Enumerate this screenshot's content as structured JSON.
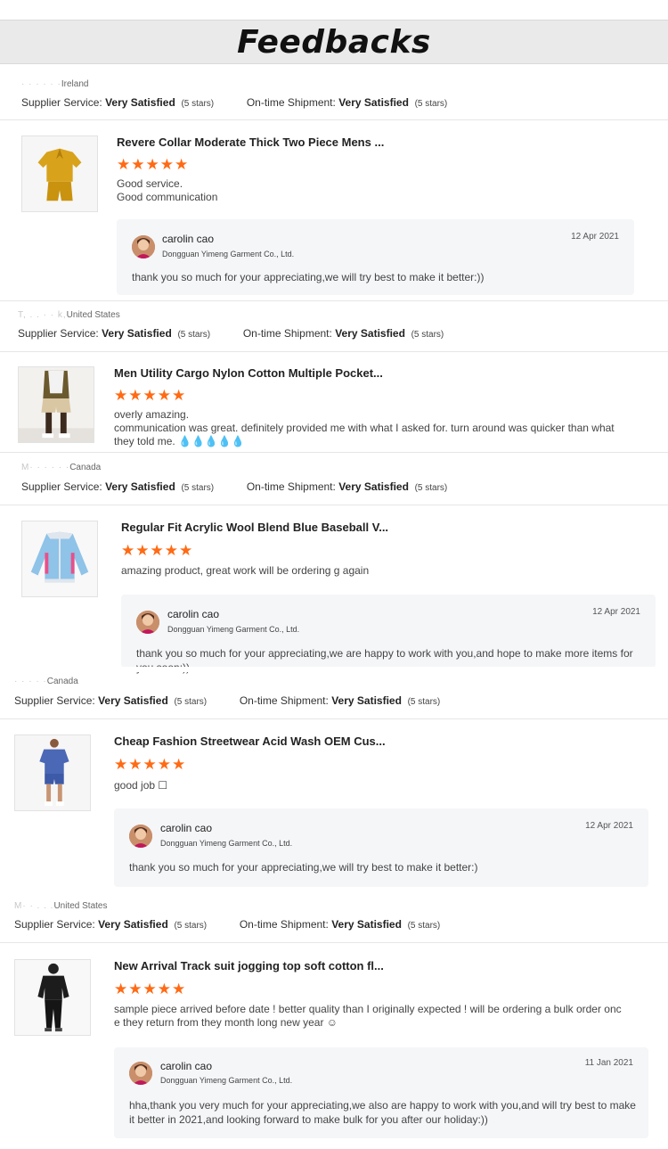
{
  "header": {
    "title": "Feedbacks"
  },
  "labels": {
    "supplier_service": "Supplier Service:",
    "ontime_shipment": "On-time Shipment:",
    "rating_text": "Very Satisfied",
    "stars_note": "(5 stars)",
    "stars_glyph": "★★★★★"
  },
  "feedbacks": [
    {
      "buyer_blur": "· · ·  · · ·",
      "buyer_country": "Ireland",
      "product_title": "Revere Collar Moderate Thick Two Piece Mens ...",
      "review": [
        "Good service.",
        "Good communication"
      ],
      "reply": {
        "name": "carolin cao",
        "company": "Dongguan Yimeng Garment Co., Ltd.",
        "date": "12 Apr 2021",
        "text": "thank you so much for your appreciating,we will try best to make it better:))"
      }
    },
    {
      "buyer_blur": "T, . . · · k,",
      "buyer_country": "United States",
      "product_title": "Men Utility Cargo Nylon Cotton Multiple Pocket...",
      "review": [
        "overly amazing.",
        "communication was great. definitely provided me with what I asked for. turn around was quicker than what",
        "they told me. 💧💧💧💧💧"
      ]
    },
    {
      "buyer_blur": "M· · ·  · · ·",
      "buyer_country": "Canada",
      "product_title": "Regular Fit Acrylic Wool Blend Blue Baseball V...",
      "review": [
        "amazing product, great work will be ordering g again"
      ],
      "reply": {
        "name": "carolin cao",
        "company": "Dongguan Yimeng Garment Co., Ltd.",
        "date": "12 Apr 2021",
        "text": "thank you so much for your appreciating,we are happy to work with you,and hope to make more items for you soon:))"
      }
    },
    {
      "buyer_blur": "· · · ·  ·",
      "buyer_country": "Canada",
      "product_title": "Cheap Fashion Streetwear Acid Wash OEM Cus...",
      "review": [
        "good job ☐"
      ],
      "reply": {
        "name": "carolin cao",
        "company": "Dongguan Yimeng Garment Co., Ltd.",
        "date": "12 Apr 2021",
        "text": "thank you so much for your appreciating,we will try best to make it better:)"
      }
    },
    {
      "buyer_blur": "M· · . . .",
      "buyer_country": "United States",
      "product_title": "New Arrival Track suit jogging top soft cotton fl...",
      "review": [
        "sample piece arrived before date ! better quality than I originally expected ! will be ordering a bulk order onc",
        "e they return from they month long new year ☺"
      ],
      "reply": {
        "name": "carolin cao",
        "company": "Dongguan Yimeng Garment Co., Ltd.",
        "date": "11 Jan 2021",
        "text": "hha,thank you very much for your appreciating,we also are happy to work with you,and will try best to make it better in 2021,and looking forward to make bulk for you after our holiday:))"
      }
    }
  ],
  "colors": {
    "star": "#ff6a14",
    "reply_bg": "#f5f6f8",
    "header_bg": "#eaeaea"
  },
  "icons": [
    "avatar-icon",
    "product-thumbnail-image"
  ]
}
